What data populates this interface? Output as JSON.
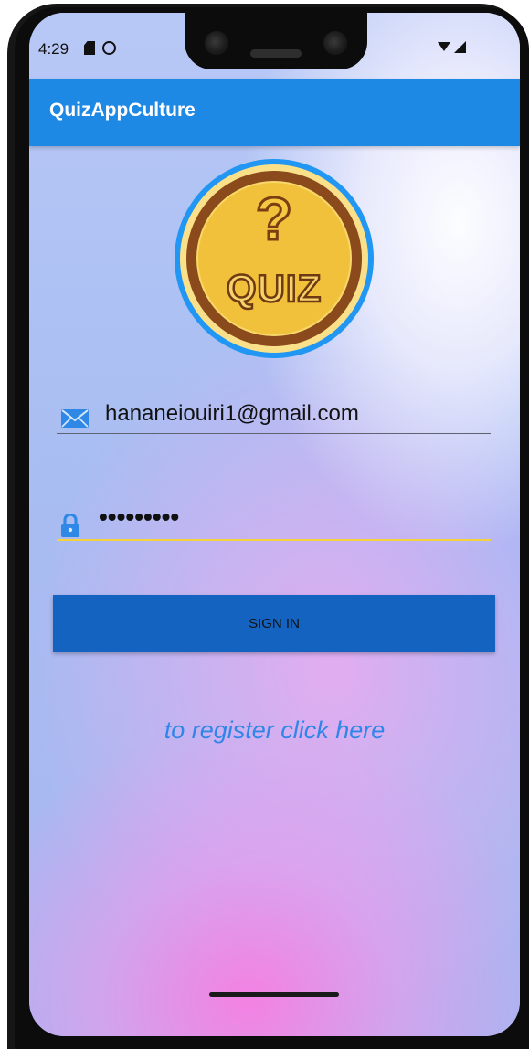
{
  "status_bar": {
    "time": "4:29",
    "icons": [
      "sd-card-icon",
      "sync-icon",
      "wifi-icon",
      "signal-icon"
    ]
  },
  "app_bar": {
    "title": "QuizAppCulture",
    "color": "#1e88e5"
  },
  "logo": {
    "question_mark": "?",
    "text": "QUIZ"
  },
  "form": {
    "email_value": "hananeiouiri1@gmail.com",
    "email_icon": "mail-icon",
    "password_value": "•••••••••",
    "password_icon": "lock-icon",
    "sign_in_label": "SIGN IN",
    "register_link": "to register click here"
  },
  "colors": {
    "accent": "#1e88e5",
    "button": "#1563c0",
    "link": "#2f86e8",
    "focus_underline": "#f3d23c"
  }
}
